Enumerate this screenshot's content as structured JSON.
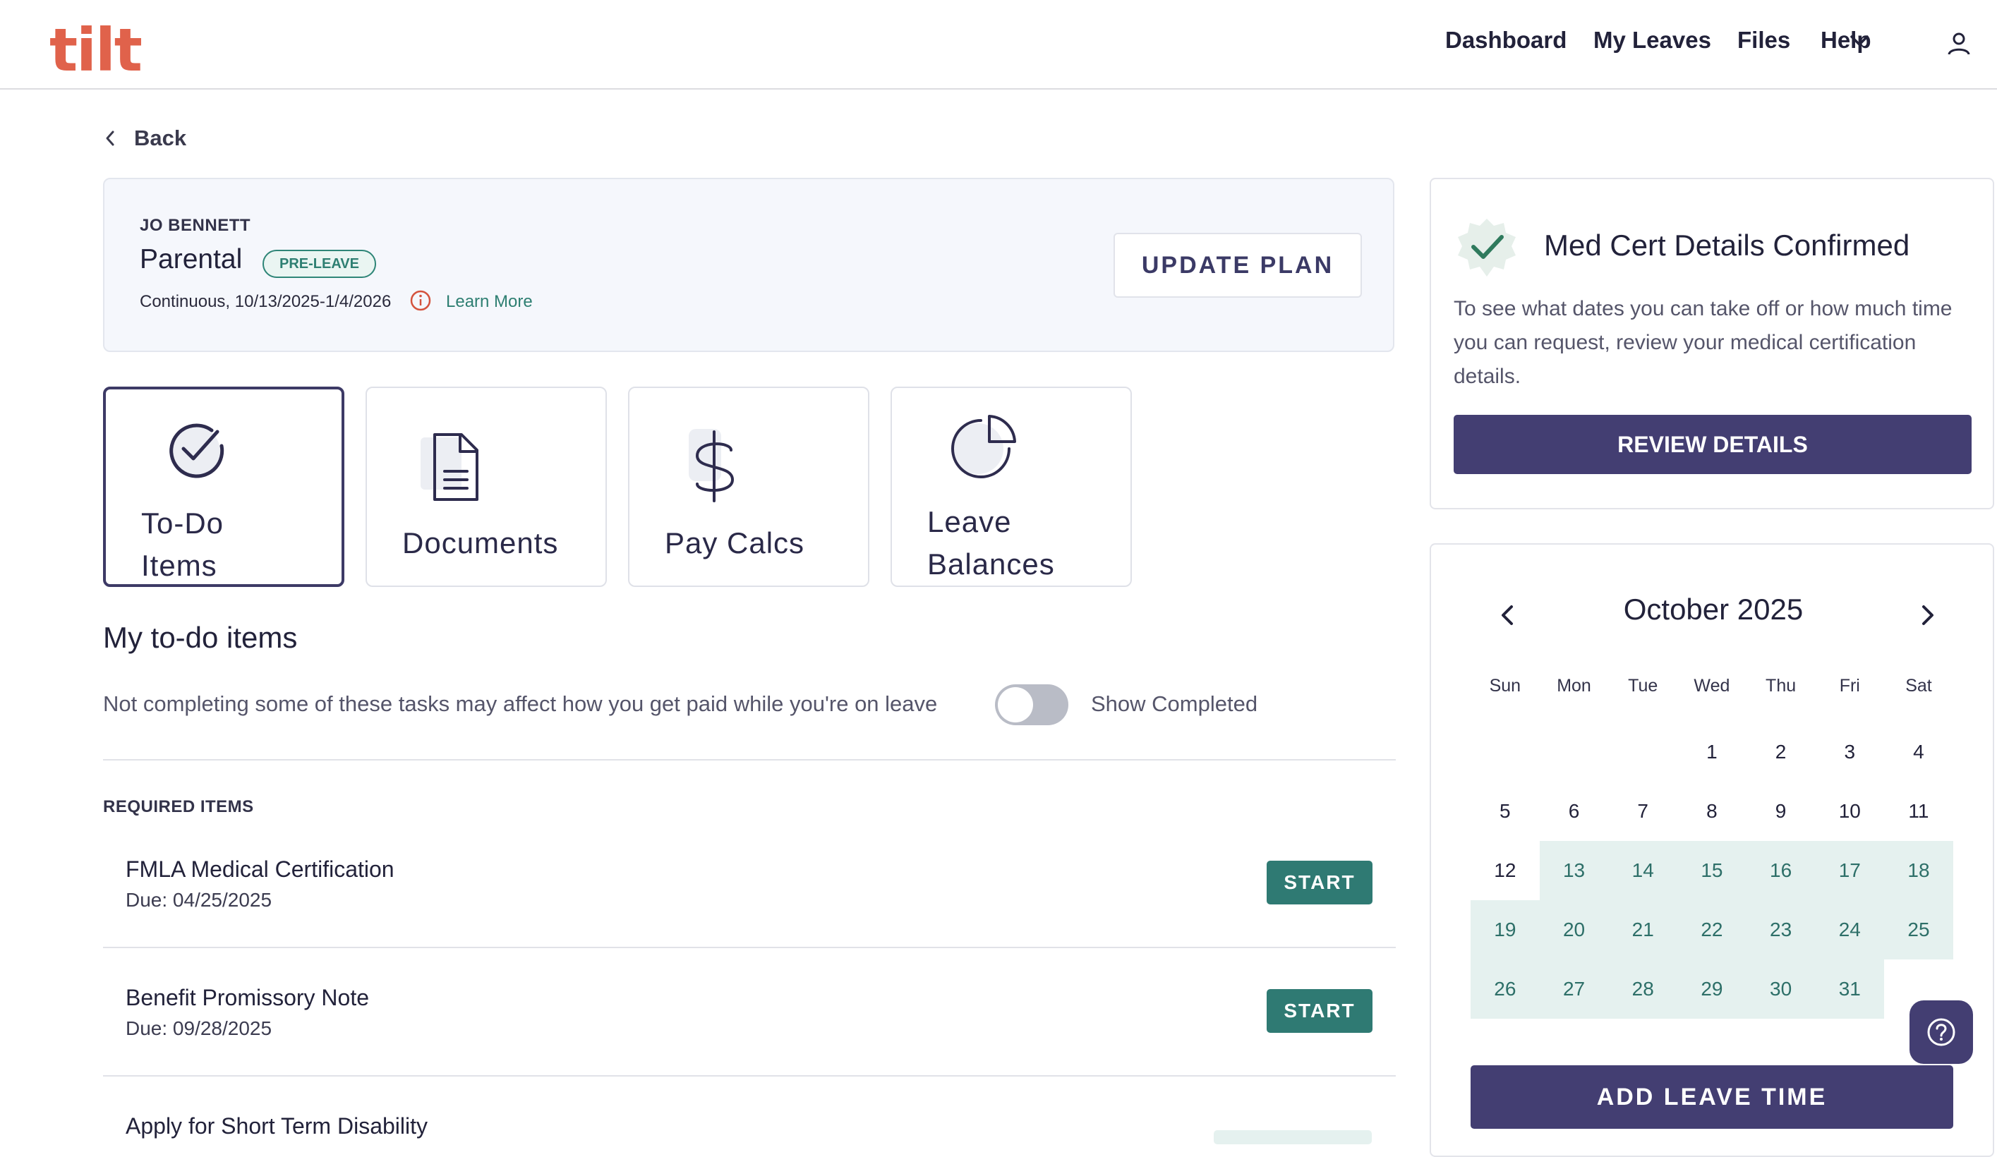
{
  "app": {
    "logo_text": "tilt"
  },
  "nav": {
    "items": [
      "Dashboard",
      "My Leaves",
      "Files",
      "Help"
    ]
  },
  "back": {
    "label": "Back"
  },
  "leave": {
    "employee": "JO BENNETT",
    "type": "Parental",
    "badge": "PRE-LEAVE",
    "dates": "Continuous, 10/13/2025-1/4/2026",
    "learn_more": "Learn More",
    "update_plan": "UPDATE PLAN"
  },
  "tiles": [
    {
      "line1": "To-Do",
      "line2": "Items",
      "icon": "check-circle-icon"
    },
    {
      "line1": "Documents",
      "line2": "",
      "icon": "document-icon"
    },
    {
      "line1": "Pay Calcs",
      "line2": "",
      "icon": "dollar-icon"
    },
    {
      "line1": "Leave",
      "line2": "Balances",
      "icon": "pie-chart-icon"
    }
  ],
  "todo": {
    "heading": "My to-do items",
    "subtext": "Not completing some of these tasks may affect how you get paid while you're on leave",
    "show_completed": "Show Completed",
    "required_label": "REQUIRED ITEMS",
    "start_label": "START",
    "items": [
      {
        "title": "FMLA Medical Certification",
        "due": "Due: 04/25/2025"
      },
      {
        "title": "Benefit Promissory Note",
        "due": "Due: 09/28/2025"
      },
      {
        "title": "Apply for Short Term Disability",
        "due": ""
      }
    ]
  },
  "med_cert": {
    "title": "Med Cert Details Confirmed",
    "text": "To see what dates you can take off or how much time you can request, review your medical certification details.",
    "button": "REVIEW DETAILS"
  },
  "calendar": {
    "month": "October 2025",
    "weekdays": [
      "Sun",
      "Mon",
      "Tue",
      "Wed",
      "Thu",
      "Fri",
      "Sat"
    ],
    "weeks": [
      [
        "",
        "",
        "",
        "1",
        "2",
        "3",
        "4"
      ],
      [
        "5",
        "6",
        "7",
        "8",
        "9",
        "10",
        "11"
      ],
      [
        "12",
        "13",
        "14",
        "15",
        "16",
        "17",
        "18"
      ],
      [
        "19",
        "20",
        "21",
        "22",
        "23",
        "24",
        "25"
      ],
      [
        "26",
        "27",
        "28",
        "29",
        "30",
        "31",
        ""
      ]
    ],
    "highlighted_days": [
      "13",
      "14",
      "15",
      "16",
      "17",
      "18",
      "19",
      "20",
      "21",
      "22",
      "23",
      "24",
      "25",
      "26",
      "27",
      "28",
      "29",
      "30",
      "31"
    ],
    "add_button": "ADD LEAVE TIME"
  },
  "colors": {
    "brand": "#e0624b",
    "primary": "#433e72",
    "teal": "#2f7a73",
    "highlight": "#e5f1ef"
  }
}
